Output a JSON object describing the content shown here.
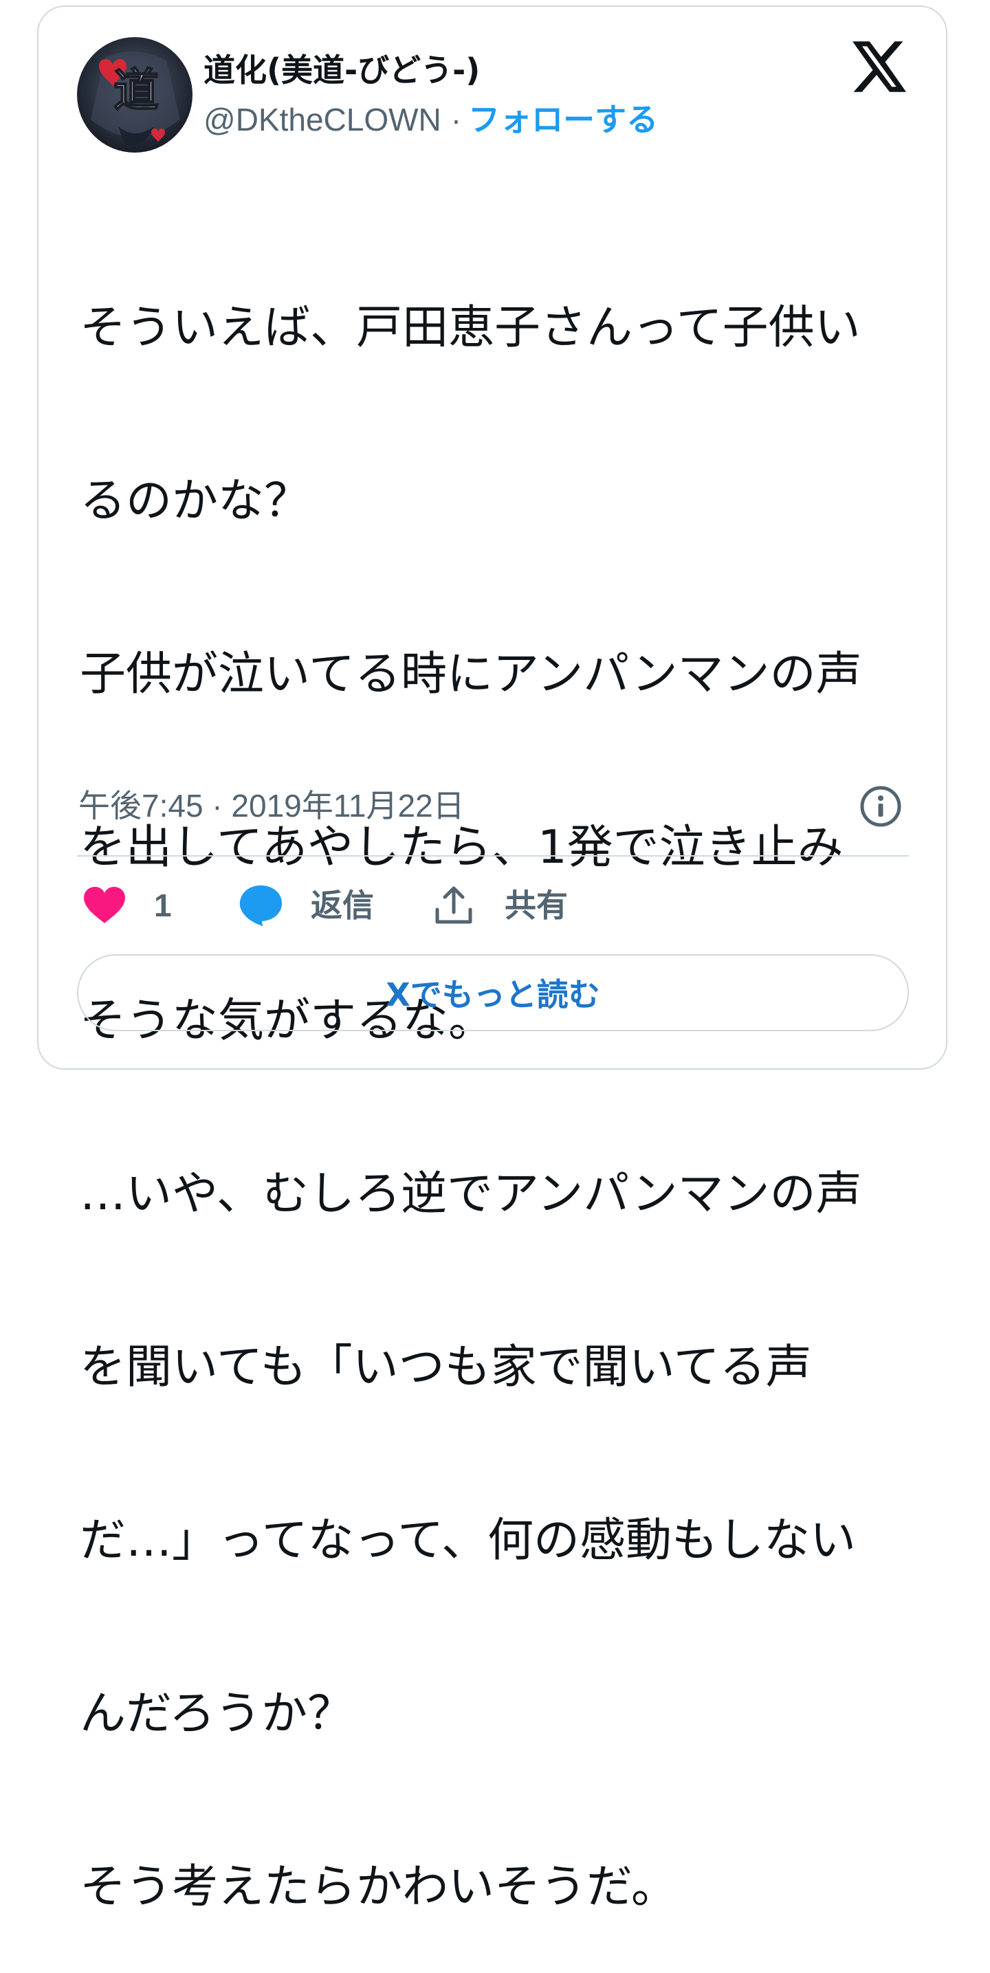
{
  "author": {
    "display_name": "道化(美道-びどう-)",
    "handle": "@DKtheCLOWN",
    "separator": "·",
    "follow_label": "フォローする",
    "avatar_text": "道"
  },
  "tweet": {
    "lines": [
      "そういえば、戸田恵子さんって子供い",
      "るのかな？",
      "子供が泣いてる時にアンパンマンの声",
      "を出してあやしたら、1発で泣き止み",
      "そうな気がするな。",
      "…いや、むしろ逆でアンパンマンの声",
      "を聞いても「いつも家で聞いてる声",
      "だ…」ってなって、何の感動もしない",
      "んだろうか？",
      "そう考えたらかわいそうだ。"
    ],
    "timestamp": "午後7:45 · 2019年11月22日"
  },
  "actions": {
    "like_count": "1",
    "reply_label": "返信",
    "share_label": "共有"
  },
  "read_more_label": "Xでもっと読む",
  "colors": {
    "accent": "#1d9bf0",
    "like": "#f91880",
    "muted": "#536471",
    "border": "#cfd9de",
    "text": "#0f1419"
  },
  "icons": [
    "x-logo-icon",
    "info-icon",
    "heart-icon",
    "reply-bubble-icon",
    "share-icon"
  ]
}
